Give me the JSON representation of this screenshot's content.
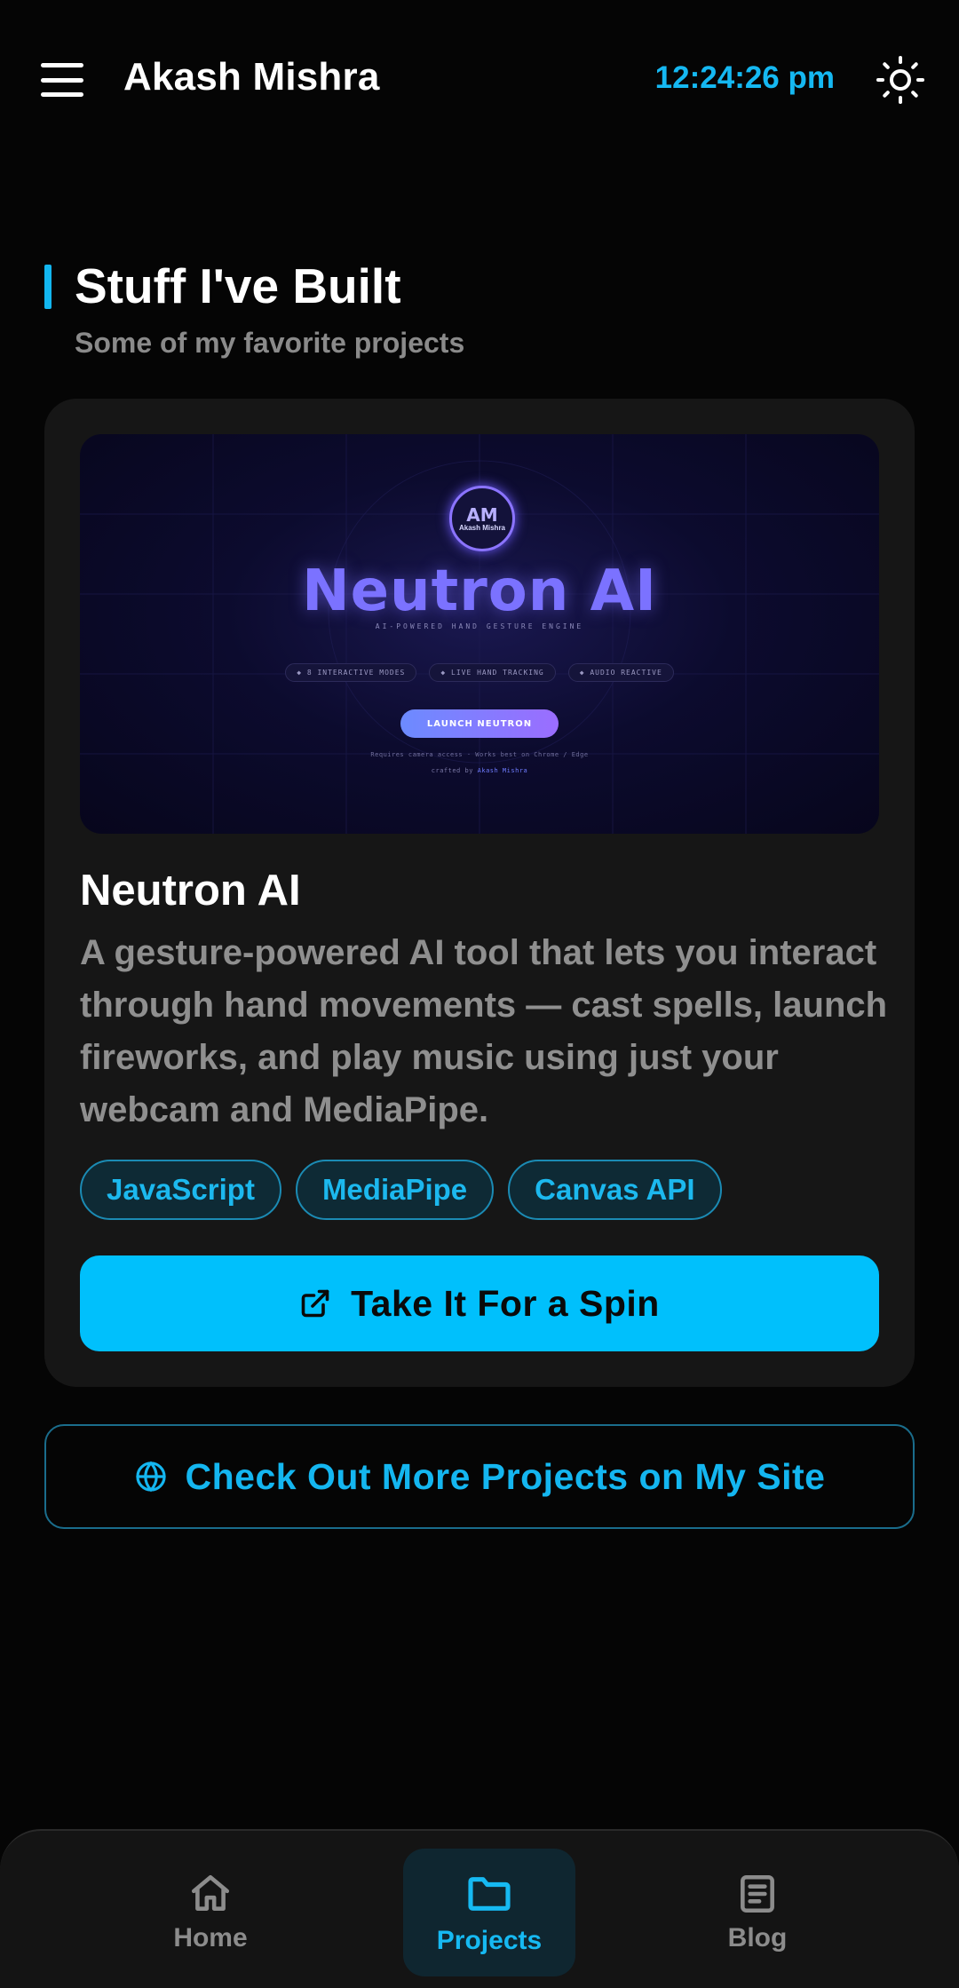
{
  "header": {
    "brand": "Akash Mishra",
    "time": "12:24:26 pm",
    "menu_icon": "hamburger-menu-icon",
    "theme_icon": "sun-icon"
  },
  "section": {
    "title": "Stuff I've Built",
    "subtitle": "Some of my favorite projects"
  },
  "project": {
    "preview": {
      "logo_mark": "AM",
      "logo_name": "Akash Mishra",
      "title": "Neutron AI",
      "tagline": "AI-POWERED HAND GESTURE ENGINE",
      "chips": [
        "◆ 8 INTERACTIVE MODES",
        "◆ LIVE HAND TRACKING",
        "◆ AUDIO REACTIVE"
      ],
      "launch_label": "LAUNCH NEUTRON",
      "note": "Requires camera access  ·  Works best on Chrome / Edge",
      "credit_prefix": "crafted by",
      "credit_name": "Akash Mishra"
    },
    "title": "Neutron AI",
    "description": "A gesture-powered AI tool that lets you interact through hand movements — cast spells, launch fireworks, and play music using just your webcam and MediaPipe.",
    "tags": [
      "JavaScript",
      "MediaPipe",
      "Canvas API"
    ],
    "cta_label": "Take It For a Spin",
    "cta_icon": "external-link-icon"
  },
  "more_projects": {
    "label": "Check Out More Projects on My Site",
    "icon": "globe-icon"
  },
  "nav": {
    "items": [
      {
        "label": "Home",
        "icon": "home-icon",
        "active": false
      },
      {
        "label": "Projects",
        "icon": "folder-icon",
        "active": true
      },
      {
        "label": "Blog",
        "icon": "document-icon",
        "active": false
      }
    ]
  },
  "colors": {
    "accent": "#00c0fc",
    "background": "#050505",
    "card": "#161616"
  }
}
